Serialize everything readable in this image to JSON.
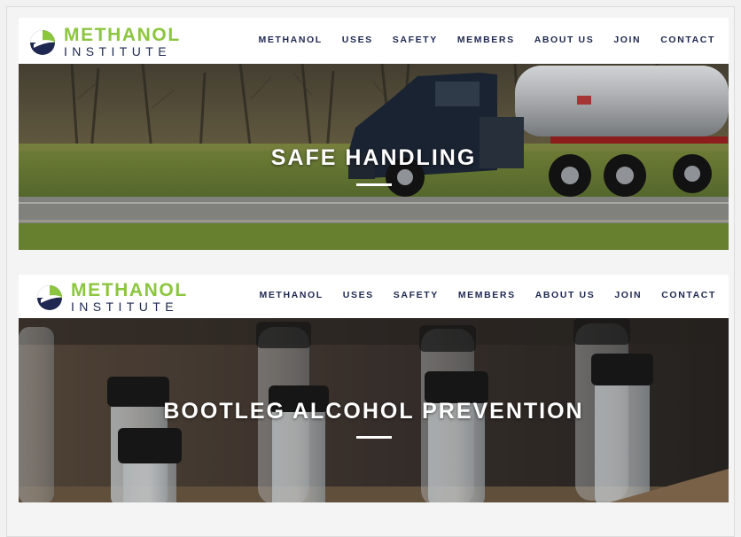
{
  "brand": {
    "word1": "METHANOL",
    "word2": "INSTITUTE",
    "green": "#8cc63f",
    "navy": "#1e2850"
  },
  "nav": {
    "items": [
      "METHANOL",
      "USES",
      "SAFETY",
      "MEMBERS",
      "ABOUT US",
      "JOIN",
      "CONTACT"
    ]
  },
  "sections": [
    {
      "title": "SAFE HANDLING"
    },
    {
      "title": "BOOTLEG ALCOHOL PREVENTION"
    }
  ]
}
